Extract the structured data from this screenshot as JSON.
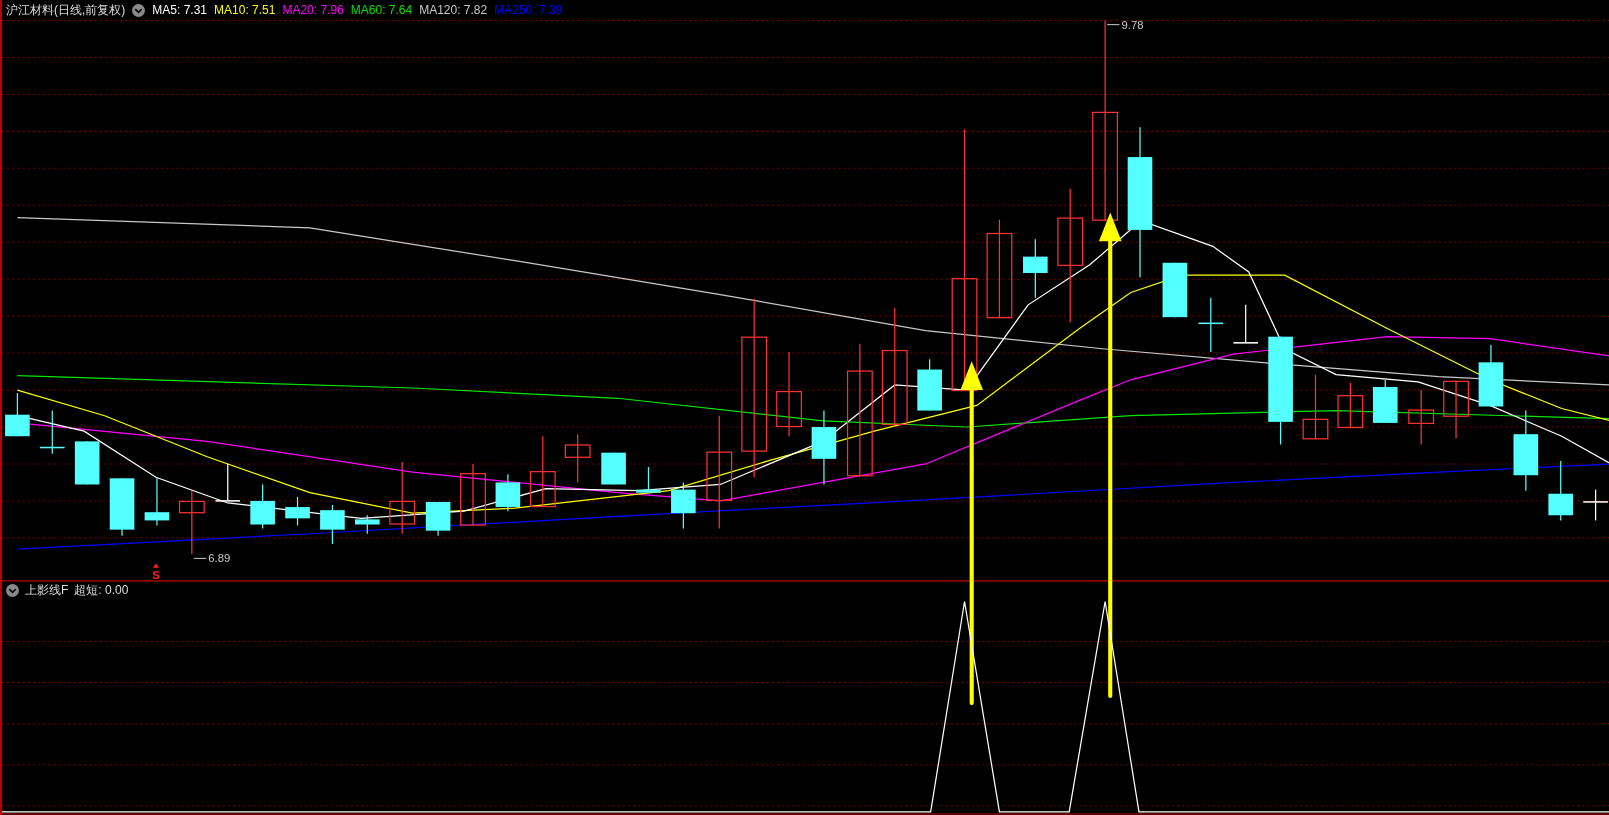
{
  "title": "沪江材料(日线,前复权)",
  "ma_legend": [
    {
      "label": "MA5: 7.31",
      "color": "#ffffff"
    },
    {
      "label": "MA10: 7.51",
      "color": "#ffff00"
    },
    {
      "label": "MA20: 7.96",
      "color": "#ff00ff"
    },
    {
      "label": "MA60: 7.64",
      "color": "#00e600"
    },
    {
      "label": "MA120: 7.82",
      "color": "#c8c8c8"
    },
    {
      "label": "MA250: 7.39",
      "color": "#0000ff"
    }
  ],
  "price_markers": [
    {
      "kind": "high",
      "text": "9.78"
    },
    {
      "kind": "low",
      "text": "6.89"
    }
  ],
  "signal_marker": "S",
  "indicator": {
    "name": "上影线F",
    "reading": "超短: 0.00"
  }
}
